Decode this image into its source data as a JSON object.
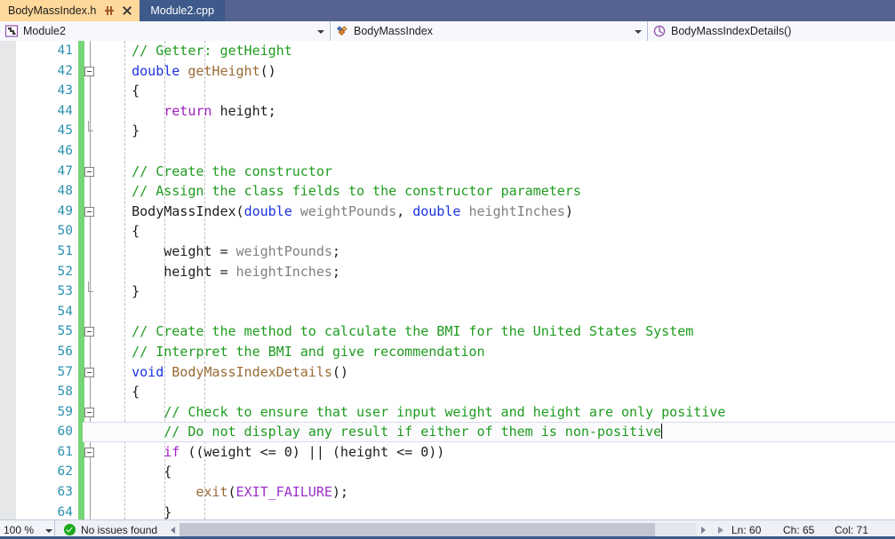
{
  "tabs": [
    {
      "label": "BodyMassIndex.h",
      "active": true,
      "pin_icon": "pin-icon",
      "close_icon": "close-icon"
    },
    {
      "label": "Module2.cpp",
      "active": false
    }
  ],
  "navbar": {
    "project": {
      "label": "Module2",
      "icon": "namespace-icon"
    },
    "class": {
      "label": "BodyMassIndex",
      "icon": "class-icon"
    },
    "member": {
      "label": "BodyMassIndexDetails()",
      "icon": "method-icon"
    }
  },
  "editor": {
    "lines": [
      {
        "num": "41",
        "indent": 0,
        "fold": "none",
        "tokens": [
          {
            "t": "    // Getter: getHeight",
            "c": "t-cmt"
          }
        ]
      },
      {
        "num": "42",
        "indent": 0,
        "fold": "open",
        "tokens": [
          {
            "t": "    ",
            "c": "t-pl"
          },
          {
            "t": "double",
            "c": "t-kw"
          },
          {
            "t": " ",
            "c": "t-pl"
          },
          {
            "t": "getHeight",
            "c": "t-fn"
          },
          {
            "t": "()",
            "c": "t-pl"
          }
        ]
      },
      {
        "num": "43",
        "indent": 0,
        "fold": "none",
        "tokens": [
          {
            "t": "    {",
            "c": "t-pl"
          }
        ]
      },
      {
        "num": "44",
        "indent": 0,
        "fold": "none",
        "tokens": [
          {
            "t": "        ",
            "c": "t-pl"
          },
          {
            "t": "return",
            "c": "t-kw2"
          },
          {
            "t": " height;",
            "c": "t-pl"
          }
        ]
      },
      {
        "num": "45",
        "indent": 0,
        "fold": "end",
        "tokens": [
          {
            "t": "    }",
            "c": "t-pl"
          }
        ]
      },
      {
        "num": "46",
        "indent": 0,
        "fold": "none",
        "tokens": []
      },
      {
        "num": "47",
        "indent": 0,
        "fold": "open",
        "tokens": [
          {
            "t": "    // Create the constructor",
            "c": "t-cmt"
          }
        ]
      },
      {
        "num": "48",
        "indent": 0,
        "fold": "none",
        "tokens": [
          {
            "t": "    // Assign the class fields to the constructor parameters",
            "c": "t-cmt"
          }
        ]
      },
      {
        "num": "49",
        "indent": 0,
        "fold": "open",
        "tokens": [
          {
            "t": "    ",
            "c": "t-pl"
          },
          {
            "t": "BodyMassIndex",
            "c": "t-pl"
          },
          {
            "t": "(",
            "c": "t-pl"
          },
          {
            "t": "double",
            "c": "t-kw"
          },
          {
            "t": " ",
            "c": "t-pl"
          },
          {
            "t": "weightPounds",
            "c": "t-par"
          },
          {
            "t": ", ",
            "c": "t-pl"
          },
          {
            "t": "double",
            "c": "t-kw"
          },
          {
            "t": " ",
            "c": "t-pl"
          },
          {
            "t": "heightInches",
            "c": "t-par"
          },
          {
            "t": ")",
            "c": "t-pl"
          }
        ]
      },
      {
        "num": "50",
        "indent": 0,
        "fold": "none",
        "tokens": [
          {
            "t": "    {",
            "c": "t-pl"
          }
        ]
      },
      {
        "num": "51",
        "indent": 0,
        "fold": "none",
        "tokens": [
          {
            "t": "        weight = ",
            "c": "t-pl"
          },
          {
            "t": "weightPounds",
            "c": "t-par"
          },
          {
            "t": ";",
            "c": "t-pl"
          }
        ]
      },
      {
        "num": "52",
        "indent": 0,
        "fold": "none",
        "tokens": [
          {
            "t": "        height = ",
            "c": "t-pl"
          },
          {
            "t": "heightInches",
            "c": "t-par"
          },
          {
            "t": ";",
            "c": "t-pl"
          }
        ]
      },
      {
        "num": "53",
        "indent": 0,
        "fold": "end",
        "tokens": [
          {
            "t": "    }",
            "c": "t-pl"
          }
        ]
      },
      {
        "num": "54",
        "indent": 0,
        "fold": "none",
        "tokens": []
      },
      {
        "num": "55",
        "indent": 0,
        "fold": "open",
        "tokens": [
          {
            "t": "    // Create the method to calculate the BMI for the United States System",
            "c": "t-cmt"
          }
        ]
      },
      {
        "num": "56",
        "indent": 0,
        "fold": "none",
        "tokens": [
          {
            "t": "    // Interpret the BMI and give recommendation",
            "c": "t-cmt"
          }
        ]
      },
      {
        "num": "57",
        "indent": 0,
        "fold": "open",
        "tokens": [
          {
            "t": "    ",
            "c": "t-pl"
          },
          {
            "t": "void",
            "c": "t-kw"
          },
          {
            "t": " ",
            "c": "t-pl"
          },
          {
            "t": "BodyMassIndexDetails",
            "c": "t-fn"
          },
          {
            "t": "()",
            "c": "t-pl"
          }
        ]
      },
      {
        "num": "58",
        "indent": 0,
        "fold": "none",
        "tokens": [
          {
            "t": "    {",
            "c": "t-pl"
          }
        ]
      },
      {
        "num": "59",
        "indent": 0,
        "fold": "open",
        "tokens": [
          {
            "t": "        // Check to ensure that user input weight and height are only positive",
            "c": "t-cmt"
          }
        ]
      },
      {
        "num": "60",
        "indent": 0,
        "fold": "none",
        "current": true,
        "caret": true,
        "tokens": [
          {
            "t": "        // Do not display any result if either of them is non-positive",
            "c": "t-cmt"
          }
        ]
      },
      {
        "num": "61",
        "indent": 0,
        "fold": "open",
        "tokens": [
          {
            "t": "        ",
            "c": "t-pl"
          },
          {
            "t": "if",
            "c": "t-kw2"
          },
          {
            "t": " ((weight <= 0) || (height <= 0))",
            "c": "t-pl"
          }
        ]
      },
      {
        "num": "62",
        "indent": 0,
        "fold": "none",
        "tokens": [
          {
            "t": "        {",
            "c": "t-pl"
          }
        ]
      },
      {
        "num": "63",
        "indent": 0,
        "fold": "none",
        "tokens": [
          {
            "t": "            ",
            "c": "t-pl"
          },
          {
            "t": "exit",
            "c": "t-fn"
          },
          {
            "t": "(",
            "c": "t-pl"
          },
          {
            "t": "EXIT_FAILURE",
            "c": "t-mac"
          },
          {
            "t": ");",
            "c": "t-pl"
          }
        ]
      },
      {
        "num": "64",
        "indent": 0,
        "fold": "none",
        "tokens": [
          {
            "t": "        }",
            "c": "t-pl"
          }
        ]
      }
    ],
    "colors": {
      "comment": "#1f9c1f",
      "keyword": "#1b32e0",
      "control_keyword": "#a020c0",
      "function": "#9a6a34",
      "parameter": "#808080",
      "macro": "#9b30c8",
      "line_number": "#2b91af",
      "change_bar": "#76d576"
    }
  },
  "statusbar": {
    "zoom": "100 %",
    "issues": "No issues found",
    "issues_icon": "check-circle-icon",
    "line": "Ln: 60",
    "char": "Ch: 65",
    "column": "Col: 71"
  }
}
